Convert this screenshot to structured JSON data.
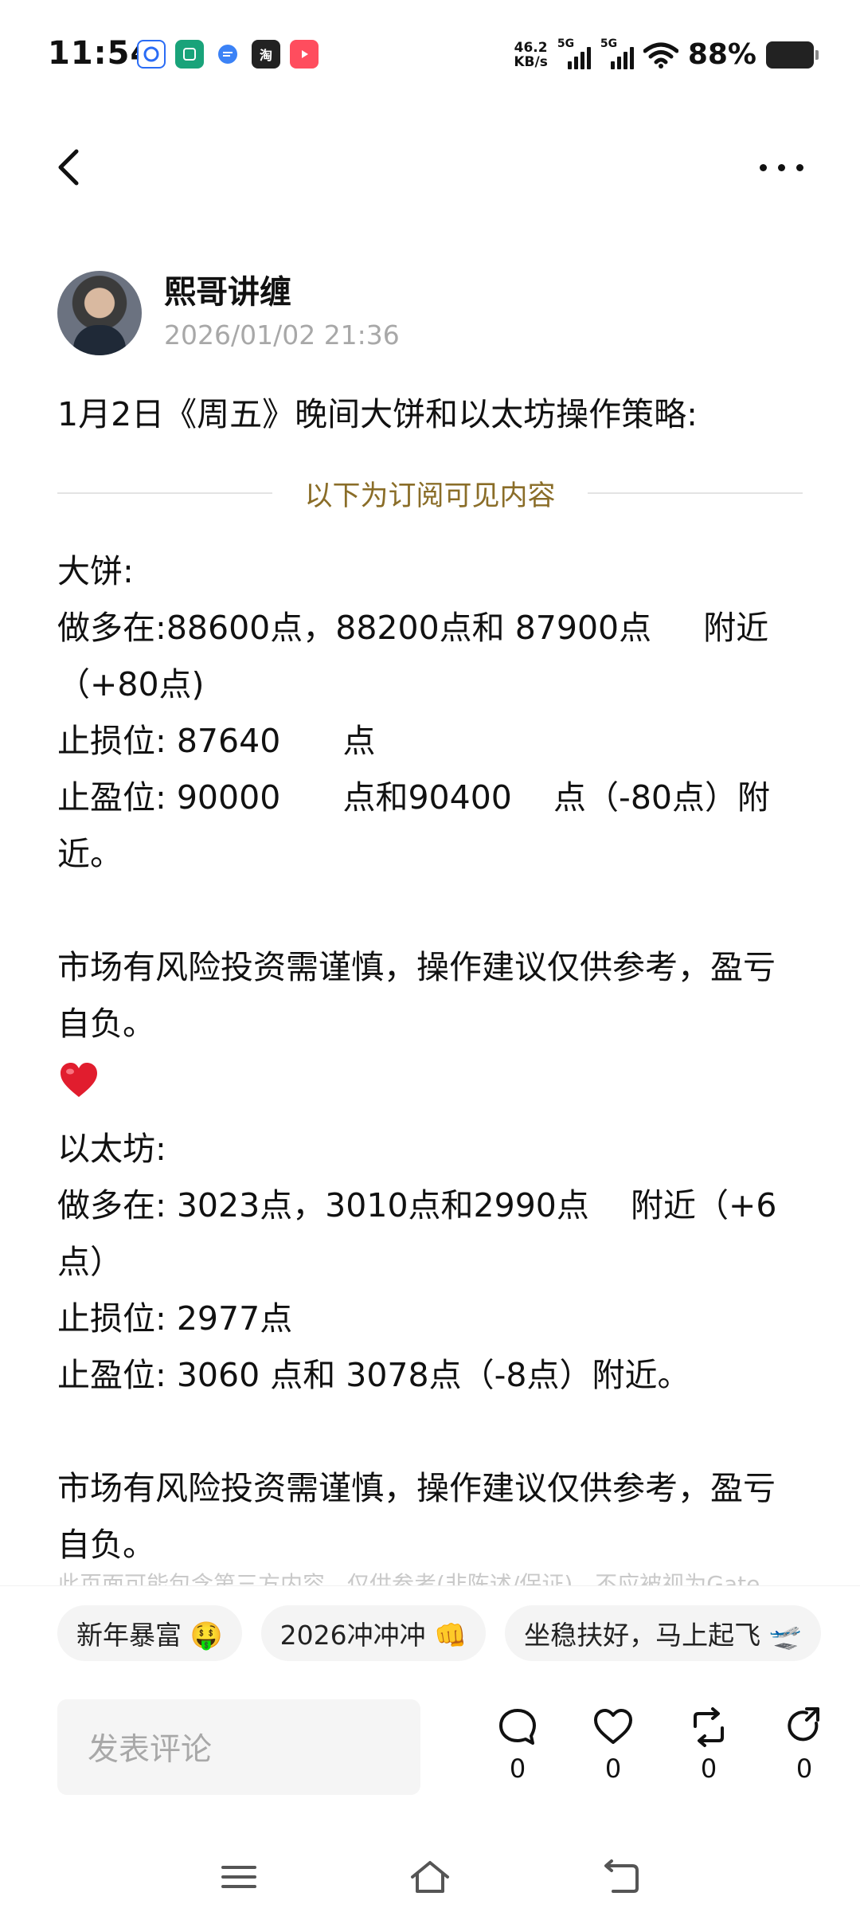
{
  "status_bar": {
    "time": "11:54",
    "net_speed_value": "46.2",
    "net_speed_unit": "KB/s",
    "sim1_label": "5G",
    "sim2_label": "5G",
    "battery": "88%",
    "app_icons": [
      "baidu-icon",
      "mini-program-icon",
      "message-icon",
      "taobao-icon",
      "video-icon"
    ],
    "taobao_glyph": "淘"
  },
  "post": {
    "author": "熙哥讲缠",
    "timestamp": "2026/01/02 21:36",
    "title": "1月2日《周五》晚间大饼和以太坊操作策略:",
    "subscriber_divider": "以下为订阅可见内容",
    "lines": {
      "btc_header": "大饼:",
      "btc_long": "做多在:88600点，88200点和 87900点     附近（+80点)",
      "btc_stop": "止损位: 87640      点",
      "btc_take": "止盈位: 90000      点和90400    点（-80点）附近。",
      "risk1": "市场有风险投资需谨慎，操作建议仅供参考，盈亏自负。",
      "eth_header": "以太坊:",
      "eth_long": "做多在: 3023点，3010点和2990点    附近（+6点）",
      "eth_stop": "止损位: 2977点",
      "eth_take": "止盈位: 3060 点和 3078点（-8点）附近。",
      "risk2": "市场有风险投资需谨慎，操作建议仅供参考，盈亏自负。"
    },
    "disclaimer": "此页面可能包含第三方内容，仅供参考(非陈述/保证)，不应被视为Gate"
  },
  "tags": [
    "新年暴富 🤑",
    "2026冲冲冲 👊",
    "坐稳扶好，马上起飞 🛫"
  ],
  "comment_placeholder": "发表评论",
  "actions": {
    "comment_count": "0",
    "like_count": "0",
    "repost_count": "0",
    "share_count": "0"
  },
  "colors": {
    "divider_text": "#8a6d28",
    "heart": "#e11d2e"
  }
}
